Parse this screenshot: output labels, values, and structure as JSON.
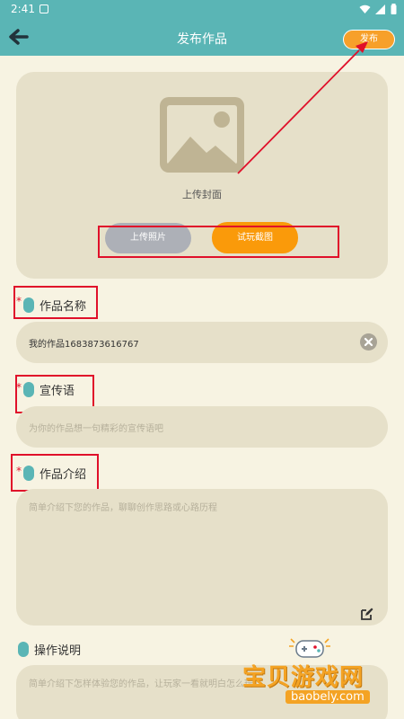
{
  "status_bar": {
    "time": "2:41"
  },
  "header": {
    "title": "发布作品",
    "publish_label": "发布"
  },
  "cover": {
    "label": "上传封面",
    "upload_photo_label": "上传照片",
    "screenshot_label": "试玩截图"
  },
  "fields": {
    "work_name": {
      "label": "作品名称",
      "required_mark": "*",
      "value": "我的作品1683873616767"
    },
    "slogan": {
      "label": "宣传语",
      "required_mark": "*",
      "placeholder": "为你的作品想一句精彩的宣传语吧"
    },
    "intro": {
      "label": "作品介绍",
      "required_mark": "*",
      "placeholder": "简单介绍下您的作品，聊聊创作思路或心路历程"
    },
    "instructions": {
      "label": "操作说明",
      "placeholder": "简单介绍下怎样体验您的作品，让玩家一看就明白怎么玩"
    }
  },
  "watermark": {
    "title": "宝贝游戏网",
    "site": "baobely.com"
  },
  "colors": {
    "header": "#5ab5b5",
    "accent_orange": "#fa9a0a",
    "annotation_red": "#e0102a",
    "background": "#f7f3e2",
    "card": "#e6e0c9"
  }
}
